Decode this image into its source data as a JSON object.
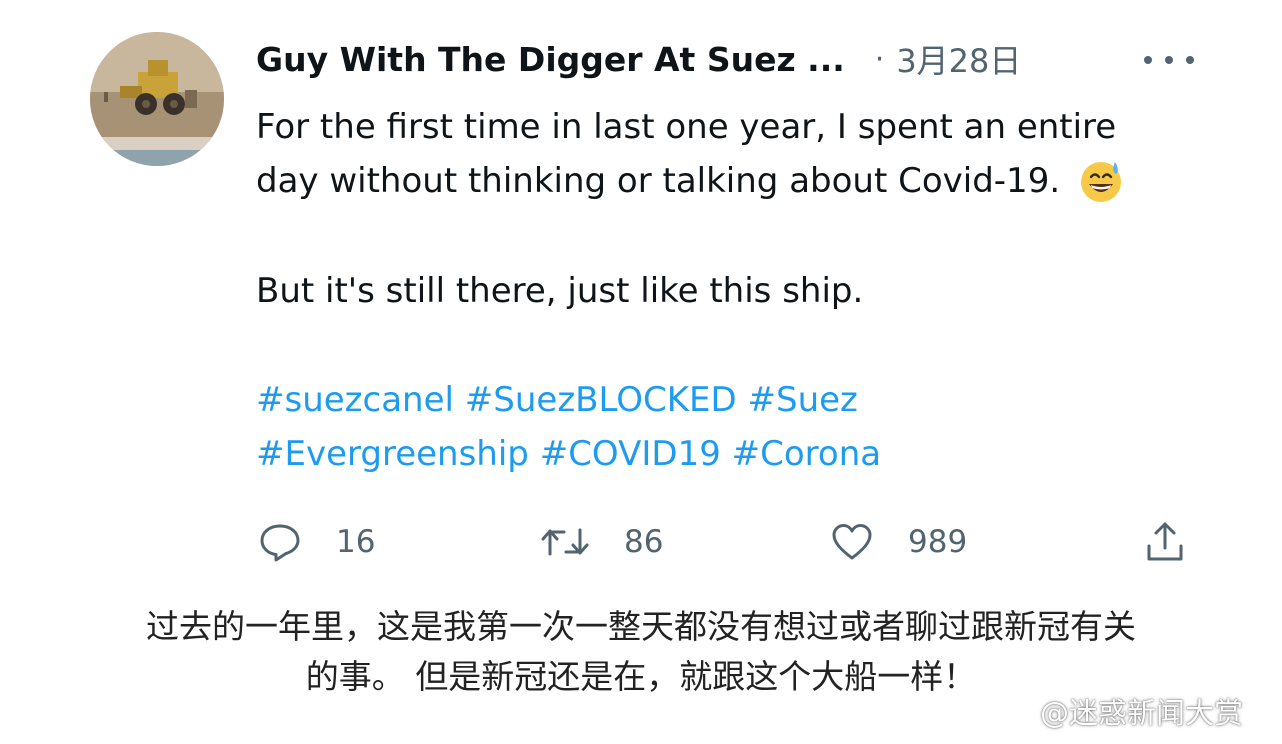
{
  "tweet": {
    "display_name": "Guy With The Digger At Suez ...",
    "separator": "·",
    "date": "3月28日",
    "text_lines": [
      "For the first time in last one year, I spent an entire",
      "day without thinking or talking about Covid-19.",
      "But it's still there, just like this ship."
    ],
    "emoji": "sweat-smile-emoji",
    "hashtag_rows": [
      [
        "#suezcanel",
        "#SuezBLOCKED",
        "#Suez"
      ],
      [
        "#Evergreenship",
        "#COVID19",
        "#Corona"
      ]
    ]
  },
  "actions": {
    "reply_count": "16",
    "retweet_count": "86",
    "like_count": "989",
    "icons": [
      "reply-icon",
      "retweet-icon",
      "like-icon",
      "share-icon"
    ]
  },
  "caption": {
    "lines": [
      "过去的一年里，这是我第一次一整天都没有想过或者聊过跟新冠有关",
      "的事。 但是新冠还是在，就跟这个大船一样！"
    ]
  },
  "watermark": {
    "text": "@迷惑新闻大赏"
  },
  "colors": {
    "link": "#1d9bf0",
    "secondary_text": "#536471",
    "primary_text": "#0f1419"
  }
}
